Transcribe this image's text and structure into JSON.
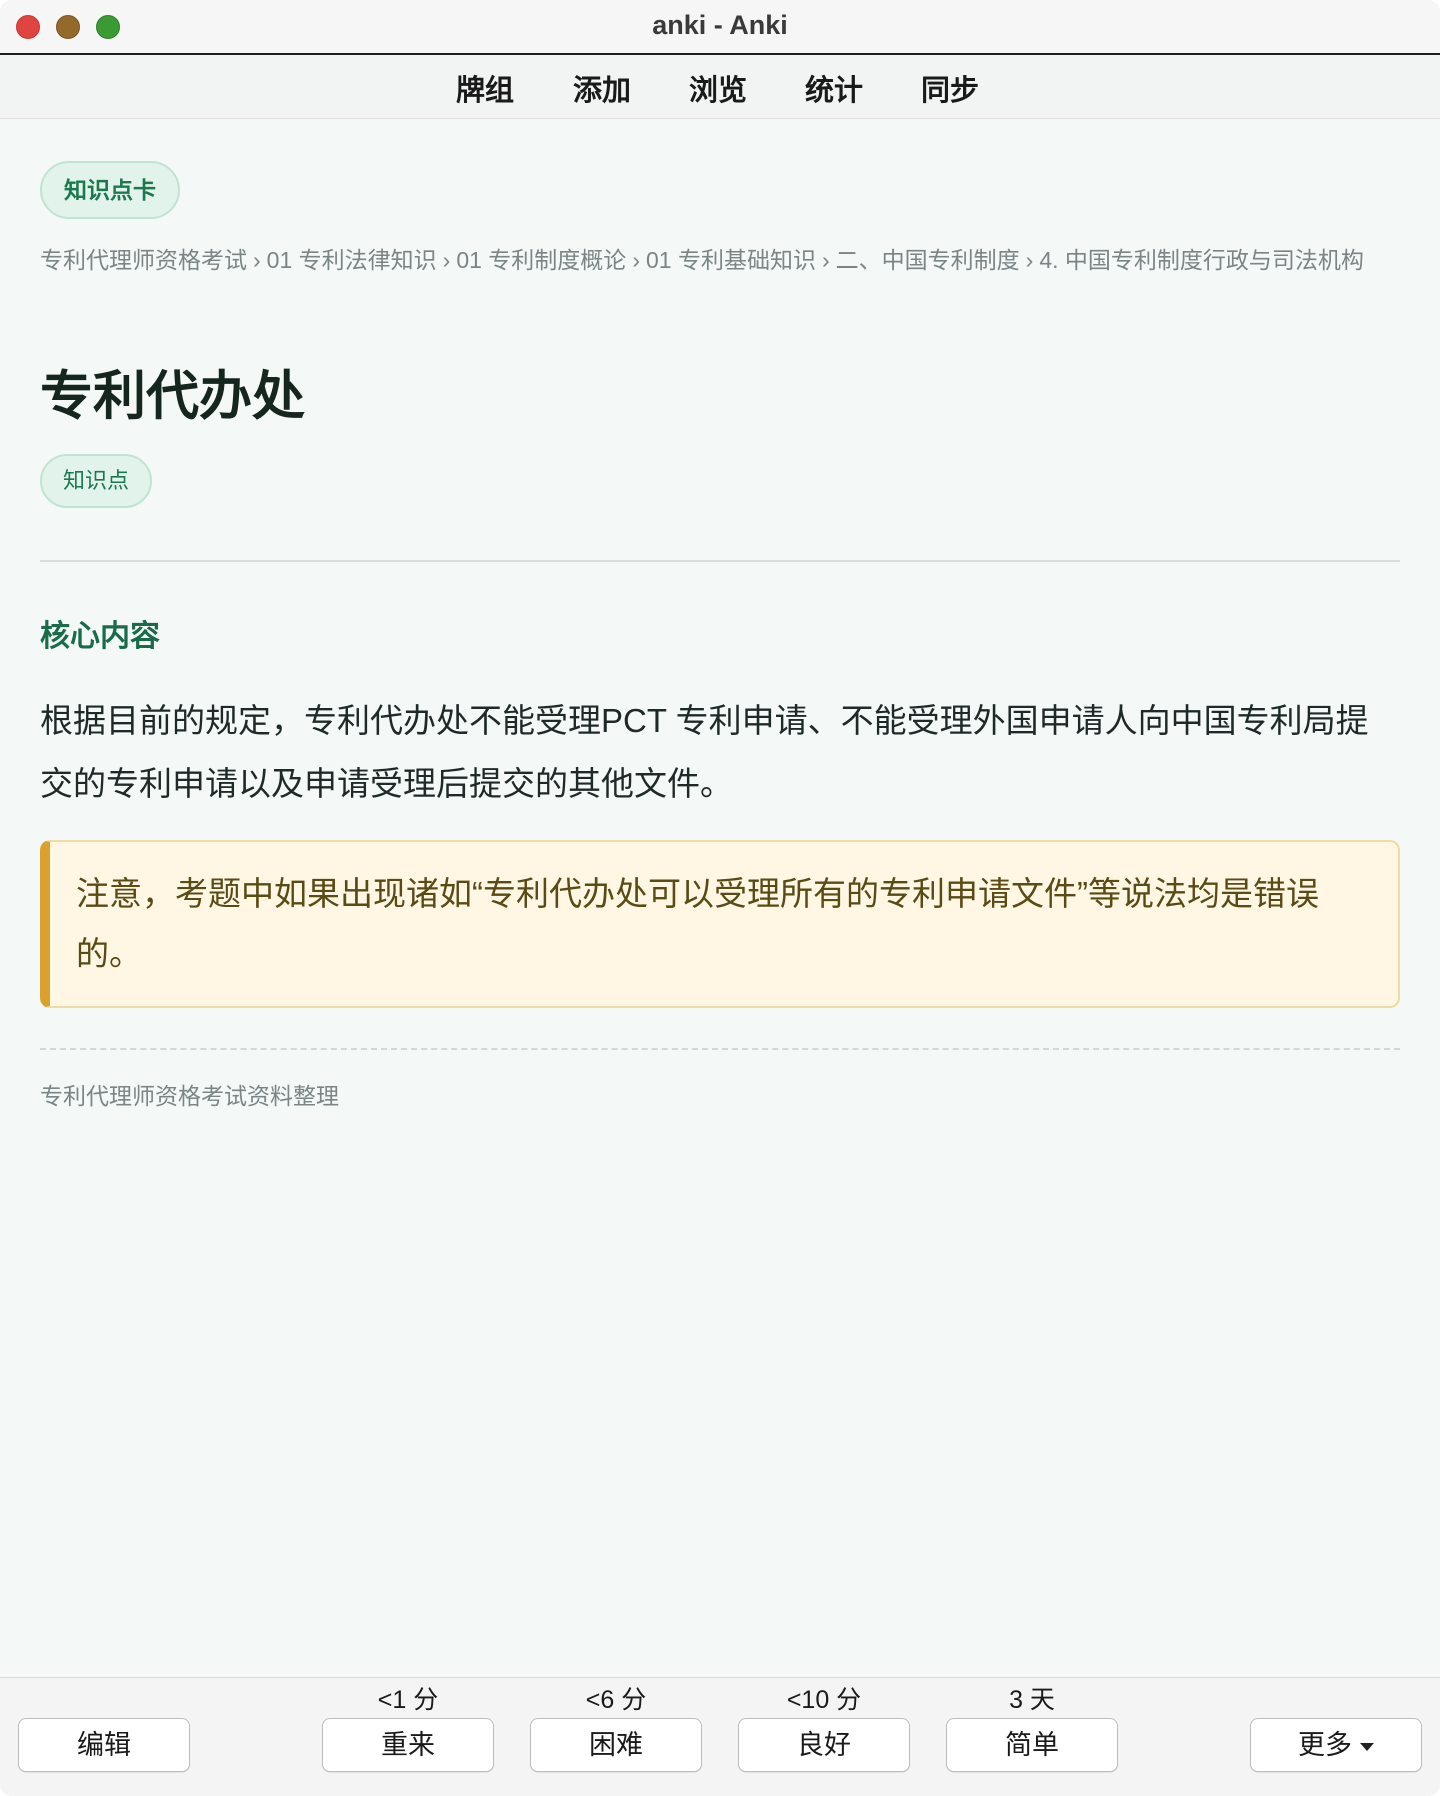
{
  "window": {
    "title": "anki - Anki"
  },
  "nav": {
    "items": [
      {
        "label": "牌组"
      },
      {
        "label": "添加"
      },
      {
        "label": "浏览"
      },
      {
        "label": "统计"
      },
      {
        "label": "同步"
      }
    ]
  },
  "card": {
    "type_badge": "知识点卡",
    "breadcrumb": [
      "专利代理师资格考试",
      "01 专利法律知识",
      "01 专利制度概论",
      "01 专利基础知识",
      "二、中国专利制度",
      "4. 中国专利制度行政与司法机构"
    ],
    "breadcrumb_sep": "›",
    "title": "专利代办处",
    "tag": "知识点",
    "section_heading": "核心内容",
    "body": "根据目前的规定，专利代办处不能受理PCT 专利申请、不能受理外国申请人向中国专利局提交的专利申请以及申请受理后提交的其他文件。",
    "callout": "注意，考题中如果出现诸如“专利代办处可以受理所有的专利申请文件”等说法均是错误的。",
    "footer": "专利代理师资格考试资料整理"
  },
  "bottom": {
    "edit_label": "编辑",
    "more_label": "更多",
    "answers": [
      {
        "interval": "<1 分",
        "label": "重来"
      },
      {
        "interval": "<6 分",
        "label": "困难"
      },
      {
        "interval": "<10 分",
        "label": "良好"
      },
      {
        "interval": "3 天",
        "label": "简单"
      }
    ]
  },
  "colors": {
    "accent_green": "#1a7a4e",
    "callout_bg": "#fff7e3",
    "callout_border": "#d9a22f",
    "close": "#e0443e",
    "minimize": "#946a2a",
    "maximize": "#3a9a33"
  }
}
